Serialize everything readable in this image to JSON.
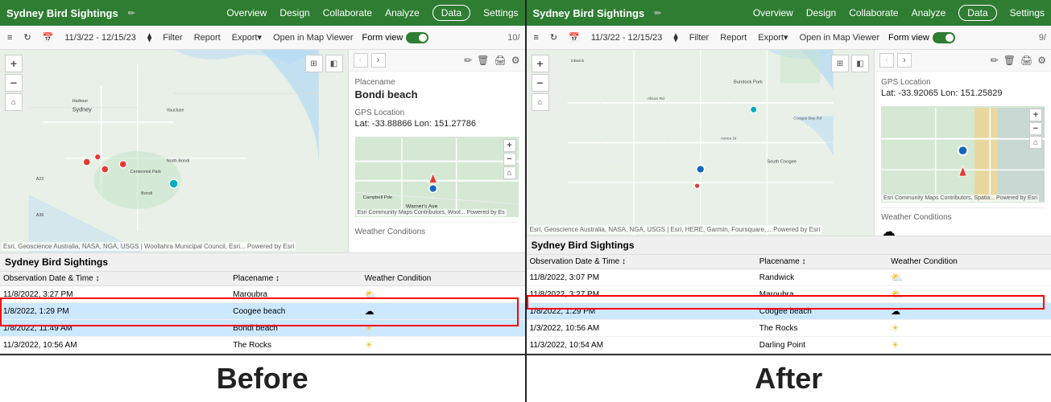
{
  "before": {
    "title": "Sydney Bird Sightings",
    "nav": {
      "overview": "Overview",
      "design": "Design",
      "collaborate": "Collaborate",
      "analyze": "Analyze",
      "data": "Data",
      "settings": "Settings"
    },
    "toolbar": {
      "date_range": "11/3/22 - 12/15/23",
      "filter": "Filter",
      "report": "Report",
      "export": "Export▾",
      "open_map": "Open in Map Viewer",
      "form_view": "Form view",
      "record_count": "10/"
    },
    "form": {
      "nav_prev": "‹",
      "nav_next": "›",
      "placename_label": "Placename",
      "placename_value": "Bondi beach",
      "gps_label": "GPS Location",
      "gps_value": "Lat: -33.88866 Lon: 151.27786",
      "weather_label": "Weather Conditions"
    },
    "table": {
      "title": "Sydney Bird Sightings",
      "headers": [
        "Observation Date & Time",
        "Placename",
        "Weather Condition"
      ],
      "rows": [
        {
          "date": "11/8/2022, 3:27 PM",
          "place": "Maroubra",
          "weather": "partly",
          "selected": false
        },
        {
          "date": "1/8/2022, 1:29 PM",
          "place": "Coogee beach",
          "weather": "cloudy",
          "selected": true,
          "red_start": true
        },
        {
          "date": "1/8/2022, 11:49 AM",
          "place": "Bondi beach",
          "weather": "sunny",
          "selected": true,
          "red_end": true
        },
        {
          "date": "11/3/2022, 10:56 AM",
          "place": "The Rocks",
          "weather": "sunny",
          "selected": false
        }
      ]
    }
  },
  "after": {
    "title": "Sydney Bird Sightings",
    "nav": {
      "overview": "Overview",
      "design": "Design",
      "collaborate": "Collaborate",
      "analyze": "Analyze",
      "data": "Data",
      "settings": "Settings"
    },
    "toolbar": {
      "date_range": "11/3/22 - 12/15/23",
      "filter": "Filter",
      "report": "Report",
      "export": "Export▾",
      "open_map": "Open in Map Viewer",
      "form_view": "Form view",
      "record_count": "9/"
    },
    "form": {
      "nav_prev": "‹",
      "nav_next": "›",
      "gps_label": "GPS Location",
      "gps_value": "Lat: -33.92065 Lon: 151.25829",
      "weather_label": "Weather Conditions"
    },
    "table": {
      "title": "Sydney Bird Sightings",
      "headers": [
        "Observation Date & Time",
        "Placename",
        "Weather Condition"
      ],
      "rows": [
        {
          "date": "11/8/2022, 3:07 PM",
          "place": "Randwick",
          "weather": "partly",
          "selected": false
        },
        {
          "date": "11/8/2022, 3:27 PM",
          "place": "Maroubra",
          "weather": "partly",
          "selected": false
        },
        {
          "date": "1/8/2022, 1:29 PM",
          "place": "Coogee beach",
          "weather": "cloudy",
          "selected": true,
          "red_start": true
        },
        {
          "date": "1/3/2022, 10:56 AM",
          "place": "The Rocks",
          "weather": "sunny",
          "selected": false,
          "red_end": true
        },
        {
          "date": "11/3/2022, 10:54 AM",
          "place": "Darling Point",
          "weather": "sunny",
          "selected": false
        }
      ]
    }
  },
  "labels": {
    "before": "Before",
    "after": "After"
  }
}
